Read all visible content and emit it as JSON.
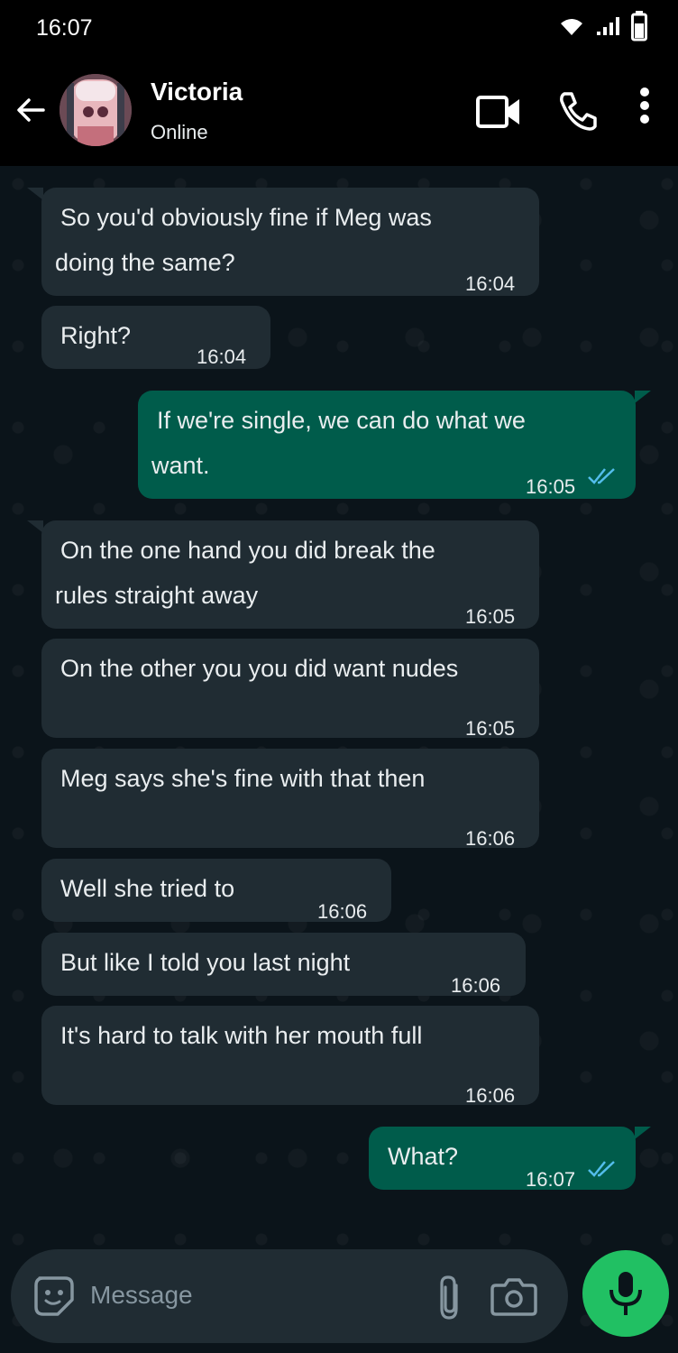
{
  "status_bar": {
    "time": "16:07"
  },
  "header": {
    "contact_name": "Victoria",
    "contact_status": "Online"
  },
  "messages": [
    {
      "direction": "in",
      "lines": [
        "So you'd obviously fine if Meg was",
        "doing the same?"
      ],
      "time": "16:04"
    },
    {
      "direction": "in",
      "lines": [
        "Right?"
      ],
      "time": "16:04"
    },
    {
      "direction": "out",
      "lines": [
        "If we're single, we can do what we",
        "want."
      ],
      "time": "16:05",
      "read": true
    },
    {
      "direction": "in",
      "lines": [
        "On the one hand you did break the",
        "rules straight away"
      ],
      "time": "16:05"
    },
    {
      "direction": "in",
      "lines": [
        "On the other you you did want nudes"
      ],
      "time": "16:05"
    },
    {
      "direction": "in",
      "lines": [
        "Meg says she's fine with that then"
      ],
      "time": "16:06"
    },
    {
      "direction": "in",
      "lines": [
        "Well she tried to"
      ],
      "time": "16:06"
    },
    {
      "direction": "in",
      "lines": [
        "But like I told you last night"
      ],
      "time": "16:06"
    },
    {
      "direction": "in",
      "lines": [
        "It's hard to talk with her mouth full"
      ],
      "time": "16:06"
    },
    {
      "direction": "out",
      "lines": [
        "What?"
      ],
      "time": "16:07",
      "read": true
    }
  ],
  "composer": {
    "placeholder": "Message"
  },
  "colors": {
    "incoming_bubble": "#202c33",
    "outgoing_bubble": "#005c4b",
    "read_ticks": "#53bdeb",
    "mic_button": "#21c063"
  },
  "icons": {
    "back": "arrow-left-icon",
    "video": "video-camera-icon",
    "call": "phone-icon",
    "menu": "more-vertical-icon",
    "sticker": "sticker-icon",
    "attach": "paperclip-icon",
    "camera": "camera-icon",
    "mic": "microphone-icon"
  }
}
